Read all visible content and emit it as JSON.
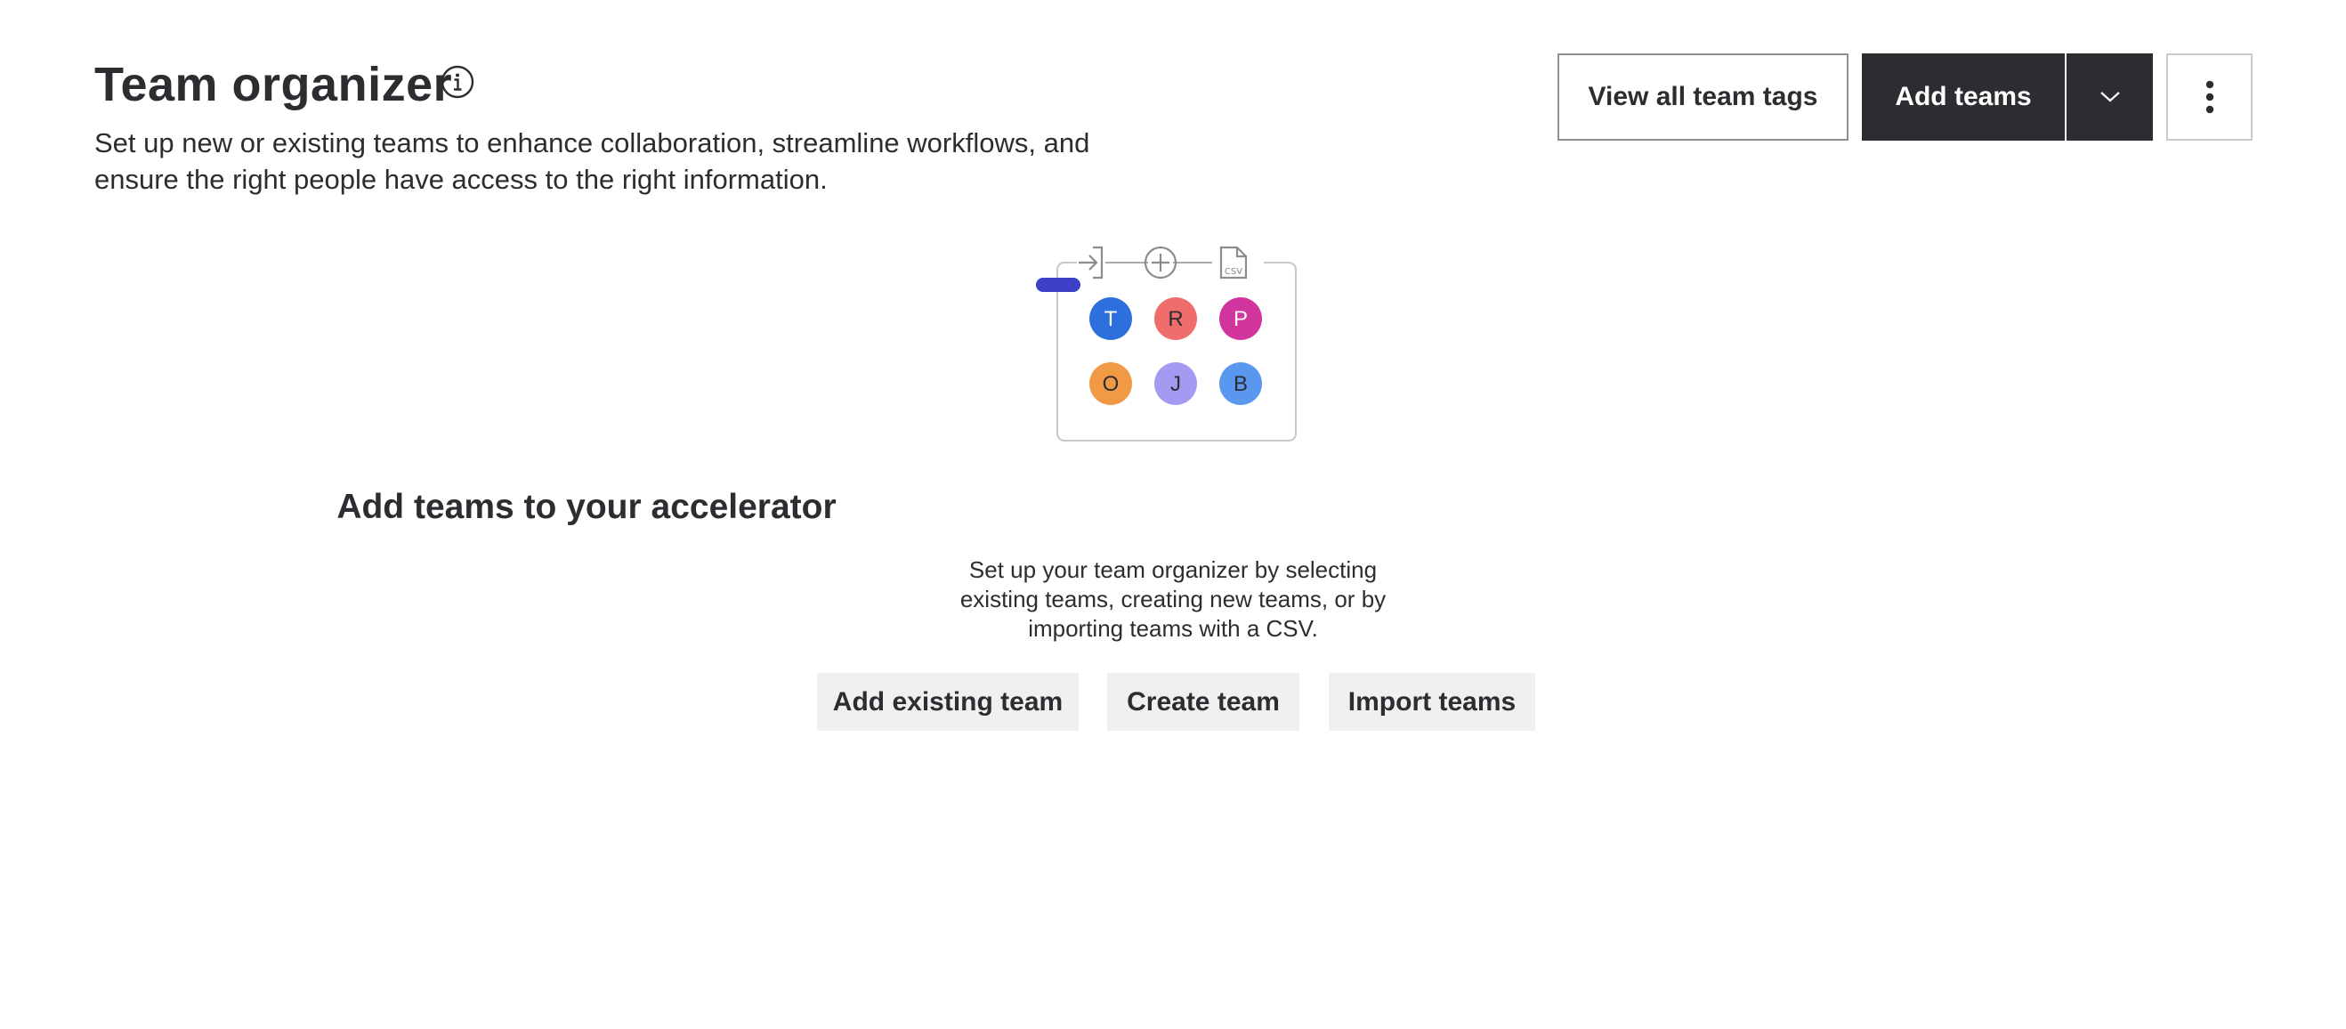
{
  "header": {
    "title": "Team organizer",
    "description": "Set up new or existing teams to enhance collaboration, streamline workflows, and ensure the right people have access to the right information.",
    "info_icon": "info-circle-icon"
  },
  "actions": {
    "view_tags_label": "View all team tags",
    "add_teams_label": "Add teams",
    "dropdown_icon": "chevron-down-icon",
    "more_icon": "vertical-ellipsis-icon"
  },
  "illustration": {
    "icons": [
      "sign-in-icon",
      "plus-circle-icon",
      "csv-file-icon"
    ],
    "csv_label": "CSV",
    "accent_color": "#3d3fc4",
    "avatars": [
      {
        "letter": "T",
        "color": "#2d6fdc",
        "text_color": "#ffffff"
      },
      {
        "letter": "R",
        "color": "#ef6d6a",
        "text_color": "#2b2d31"
      },
      {
        "letter": "P",
        "color": "#d2369e",
        "text_color": "#ffffff"
      },
      {
        "letter": "O",
        "color": "#f09a45",
        "text_color": "#2b2d31"
      },
      {
        "letter": "J",
        "color": "#a59af2",
        "text_color": "#2b2d31"
      },
      {
        "letter": "B",
        "color": "#5a98ef",
        "text_color": "#2b2d31"
      }
    ]
  },
  "empty_state": {
    "title": "Add teams to your accelerator",
    "description": "Set up your team organizer by selecting existing teams, creating new teams, or by importing teams with a CSV.",
    "buttons": [
      {
        "label": "Add existing team"
      },
      {
        "label": "Create team"
      },
      {
        "label": "Import teams"
      }
    ]
  }
}
